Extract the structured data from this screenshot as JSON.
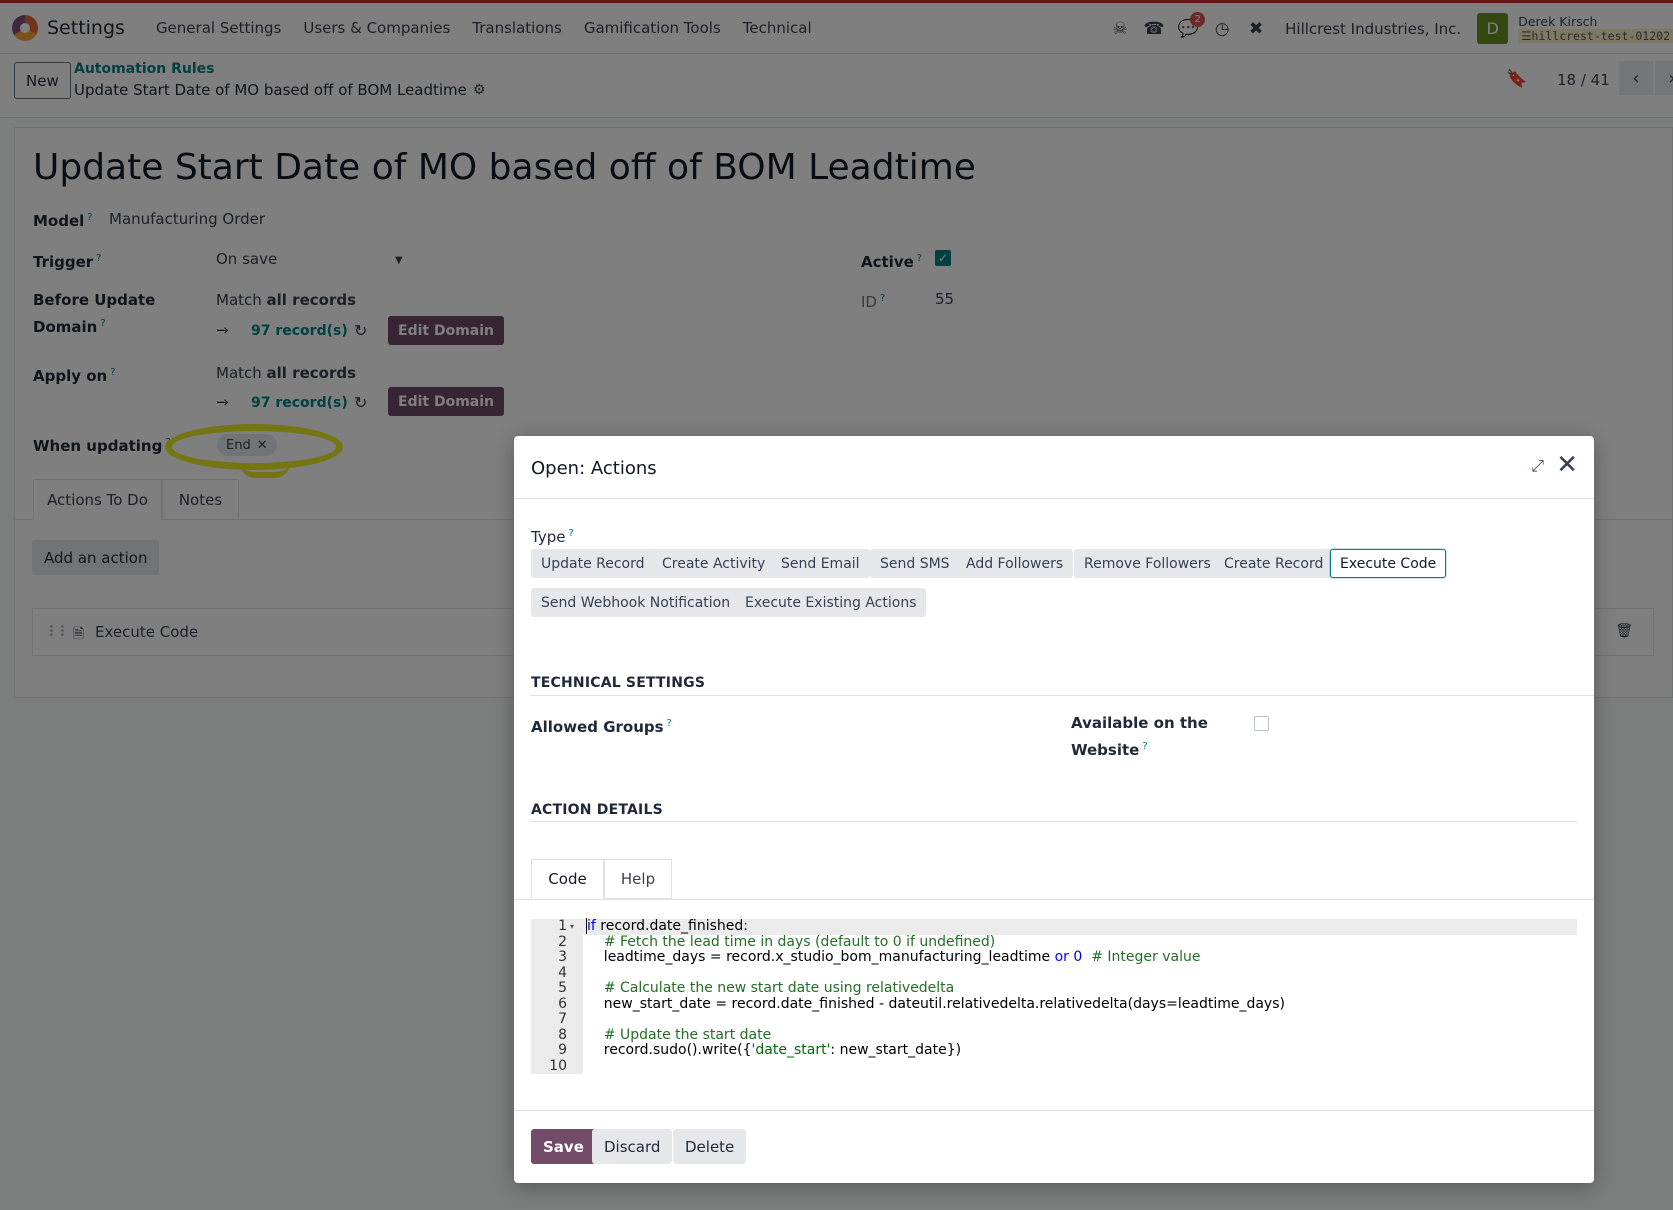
{
  "navbar": {
    "app_name": "Settings",
    "menu": [
      "General Settings",
      "Users & Companies",
      "Translations",
      "Gamification Tools",
      "Technical"
    ],
    "message_count": "2",
    "company": "Hillcrest Industries, Inc.",
    "user_initial": "D",
    "user_name": "Derek Kirsch",
    "db_name": "hillcrest-test-01202",
    "icons": [
      "bug-icon",
      "phone-icon",
      "messages-icon",
      "clock-icon",
      "tools-icon"
    ]
  },
  "control": {
    "new_label": "New",
    "breadcrumb_parent": "Automation Rules",
    "breadcrumb_current": "Update Start Date of MO based off of BOM Leadtime",
    "pager": "18 / 41"
  },
  "form": {
    "title": "Update Start Date of MO based off of BOM Leadtime",
    "model_label": "Model",
    "model_value": "Manufacturing Order",
    "trigger_label": "Trigger",
    "trigger_value": "On save",
    "before_domain_label_1": "Before Update",
    "before_domain_label_2": "Domain",
    "match_prefix": "Match ",
    "match_bold": "all records",
    "record_count": "97 record(s)",
    "edit_domain_label": "Edit Domain",
    "apply_on_label": "Apply on",
    "when_updating_label": "When updating",
    "when_updating_tag": "End",
    "active_label": "Active",
    "id_label": "ID",
    "id_value": "55",
    "tabs": [
      "Actions To Do",
      "Notes"
    ],
    "add_action_label": "Add an action",
    "action_row_name": "Execute Code"
  },
  "modal": {
    "title": "Open: Actions",
    "type_label": "Type",
    "type_options": [
      "Update Record",
      "Create Activity",
      "Send Email",
      "Send SMS",
      "Add Followers",
      "Remove Followers",
      "Create Record",
      "Execute Code",
      "Send Webhook Notification",
      "Execute Existing Actions"
    ],
    "selected_type": "Execute Code",
    "technical_settings_title": "TECHNICAL SETTINGS",
    "allowed_groups_label": "Allowed Groups",
    "available_website_label_1": "Available on the",
    "available_website_label_2": "Website",
    "action_details_title": "ACTION DETAILS",
    "code_tabs": [
      "Code",
      "Help"
    ],
    "code_lines": [
      "if record.date_finished:",
      "    # Fetch the lead time in days (default to 0 if undefined)",
      "    leadtime_days = record.x_studio_bom_manufacturing_leadtime or 0  # Integer value",
      "",
      "    # Calculate the new start date using relativedelta",
      "    new_start_date = record.date_finished - dateutil.relativedelta.relativedelta(days=leadtime_days)",
      "",
      "    # Update the start date",
      "    record.sudo().write({'date_start': new_start_date})",
      ""
    ],
    "save_label": "Save",
    "discard_label": "Discard",
    "delete_label": "Delete"
  },
  "colors": {
    "primary": "#714b67",
    "accent": "#017e84",
    "highlight": "#e6e600",
    "badge": "#d9534f"
  }
}
